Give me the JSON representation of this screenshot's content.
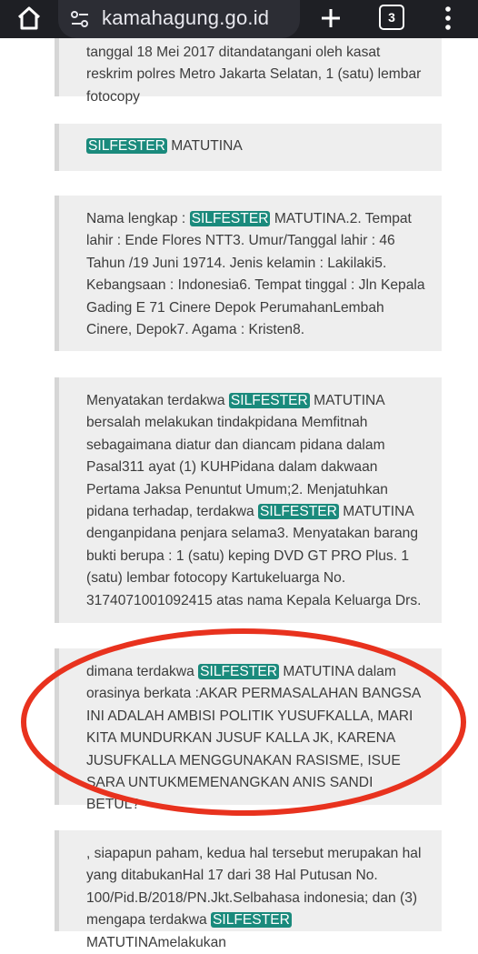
{
  "browser": {
    "url": "kamahagung.go.id",
    "tab_count": "3"
  },
  "highlight_term": "SILFESTER",
  "blocks": [
    {
      "id": "b1",
      "text_a": "tanggal 18 Mei 2017 ditandatangani oleh kasat reskrim polres Metro Jakarta Selatan, 1 (satu) lembar fotocopy"
    },
    {
      "id": "b2",
      "after": " MATUTINA"
    },
    {
      "id": "b3",
      "before": "Nama lengkap : ",
      "after": " MATUTINA.2. Tempat lahir : Ende Flores NTT3. Umur/Tanggal lahir : 46 Tahun /19 Juni 19714. Jenis kelamin : Lakilaki5. Kebangsaan : Indonesia6. Tempat tinggal : Jln Kepala Gading E 71 Cinere Depok PerumahanLembah Cinere, Depok7. Agama : Kristen8."
    },
    {
      "id": "b4",
      "before": "Menyatakan terdakwa ",
      "middle": " MATUTINA bersalah melakukan tindakpidana Memfitnah sebagaimana diatur dan diancam pidana dalam Pasal311 ayat (1) KUHPidana dalam dakwaan Pertama Jaksa Penuntut Umum;2. Menjatuhkan pidana terhadap, terdakwa ",
      "after": " MATUTINA denganpidana penjara selama3. Menyatakan barang bukti berupa : 1 (satu) keping DVD GT PRO Plus. 1 (satu) lembar fotocopy Kartukeluarga No. 3174071001092415 atas nama Kepala Keluarga Drs."
    },
    {
      "id": "b5",
      "before": "dimana terdakwa ",
      "after": " MATUTINA dalam orasinya berkata :AKAR PERMASALAHAN BANGSA INI ADALAH AMBISI POLITIK YUSUFKALLA, MARI KITA MUNDURKAN JUSUF KALLA JK, KARENA JUSUFKALLA MENGGUNAKAN RASISME, ISUE SARA UNTUKMEMENANGKAN ANIS SANDI BETUL?"
    },
    {
      "id": "b6",
      "before": ", siapapun paham, kedua hal tersebut merupakan hal yang ditabukanHal 17 dari 38 Hal Putusan No. 100/Pid.B/2018/PN.Jkt.Selbahasa indonesia; dan (3) mengapa terdakwa ",
      "after": " MATUTINAmelakukan"
    }
  ],
  "colors": {
    "highlight": "#1a8a7c",
    "annotation_circle": "#e8321e"
  }
}
